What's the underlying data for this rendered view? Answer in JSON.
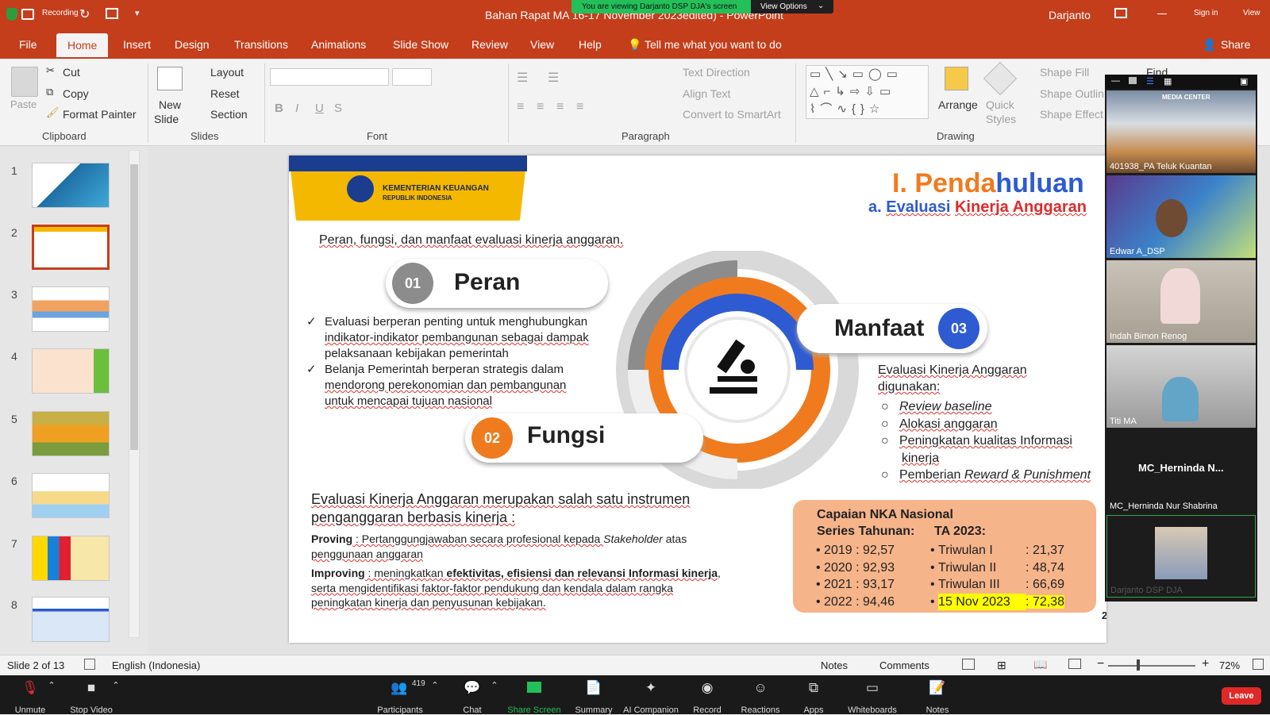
{
  "zoom_banner": {
    "text": "You are viewing Darjanto DSP DJA's screen",
    "options": "View Options"
  },
  "titlebar": {
    "recording": "Recording",
    "title": "Bahan Rapat MA 16-17 November 2023edited) - PowerPoint",
    "user": "Darjanto",
    "signin": "Sign in",
    "view": "View"
  },
  "menu": {
    "file": "File",
    "home": "Home",
    "insert": "Insert",
    "design": "Design",
    "transitions": "Transitions",
    "animations": "Animations",
    "slideshow": "Slide Show",
    "review": "Review",
    "view": "View",
    "help": "Help",
    "tell": "Tell me what you want to do",
    "share": "Share"
  },
  "ribbon": {
    "paste": "Paste",
    "cut": "Cut",
    "copy": "Copy",
    "format_painter": "Format Painter",
    "clipboard": "Clipboard",
    "new_slide_1": "New",
    "new_slide_2": "Slide",
    "layout": "Layout",
    "reset": "Reset",
    "section": "Section",
    "slides": "Slides",
    "font": "Font",
    "paragraph": "Paragraph",
    "text_direction": "Text Direction",
    "align_text": "Align Text",
    "convert_smartart": "Convert to SmartArt",
    "arrange": "Arrange",
    "quick_styles_1": "Quick",
    "quick_styles_2": "Styles",
    "shape_fill": "Shape Fill",
    "shape_outline": "Shape Outlin",
    "shape_effects": "Shape Effect",
    "drawing": "Drawing",
    "find": "Find"
  },
  "thumbnails": [
    "1",
    "2",
    "3",
    "4",
    "5",
    "6",
    "7",
    "8"
  ],
  "slide": {
    "ministry_1": "KEMENTERIAN KEUANGAN",
    "ministry_2": "REPUBLIK INDONESIA",
    "title_a": "I. Penda",
    "title_b": "huluan",
    "subtitle_a": "a. ",
    "subtitle_b": "Evaluasi",
    "subtitle_c": "Kinerja Anggaran",
    "intro": "Peran, fungsi, dan manfaat evaluasi kinerja anggaran.",
    "n01": "01",
    "peran": "Peran",
    "n02": "02",
    "fungsi": "Fungsi",
    "n03": "03",
    "manfaat": "Manfaat",
    "check": "✓",
    "peran_b1": [
      "Evaluasi berperan penting untuk menghubungkan",
      "indikator-indikator pembangunan sebagai dampak",
      "pelaksanaan kebijakan pemerintah"
    ],
    "peran_b2": [
      "Belanja Pemerintah berperan strategis dalam",
      "mendorong perekonomian dan pembangunan",
      "untuk mencapai tujuan nasional"
    ],
    "manfaat_head": [
      "Evaluasi Kinerja Anggaran",
      "digunakan:"
    ],
    "manfaat_items": [
      "Review baseline",
      "Alokasi anggaran",
      "Peningkatan kualitas Informasi",
      "kinerja",
      "Pemberian ",
      "Reward & Punishment"
    ],
    "instr": [
      "Evaluasi Kinerja Anggaran merupakan salah satu instrumen",
      "penganggaran berbasis kinerja :"
    ],
    "proving_label": "Proving",
    "proving_text": " : Pertanggungjawaban secara profesional kepada ",
    "stakeholder": "Stakeholder",
    "proving_end": " atas",
    "proving_2": "penggunaan anggaran",
    "improving_label": "Improving",
    "improving_text": " : meningkatkan ",
    "improving_bold": "efektivitas, efisiensi dan relevansi Informasi kinerja",
    ",": ",",
    "improving_2": "serta mengidentifikasi faktor-faktor pendukung dan kendala dalam rangka",
    "improving_3": "peningkatan kinerja dan penyusunan kebijakan.",
    "capaian_title": "Capaian NKA Nasional",
    "series_title": "Series Tahunan:",
    "ta_title": "TA 2023:",
    "series": [
      {
        "y": "2019",
        "v": "92,57"
      },
      {
        "y": "2020",
        "v": "92,93"
      },
      {
        "y": "2021",
        "v": "93,17"
      },
      {
        "y": "2022",
        "v": "94,46"
      }
    ],
    "ta": [
      {
        "k": "Triwulan I",
        "v": ": 21,37"
      },
      {
        "k": "Triwulan II",
        "v": ": 48,74"
      },
      {
        "k": "Triwulan III",
        "v": ": 66,69"
      },
      {
        "k": "15 Nov 2023",
        "v": ": 72,38"
      }
    ],
    "page_no": "2"
  },
  "participants": [
    "401938_PA Teluk Kuantan",
    "Edwar A_DSP",
    "Indah Bimon Renog",
    "Titi MA",
    "MC_Herninda  N...",
    "MC_Herninda Nur Shabrina",
    "Darjanto DSP DJA"
  ],
  "video_banner": "MEDIA CENTER",
  "status": {
    "slide": "Slide 2 of 13",
    "language": "English (Indonesia)",
    "notes": "Notes",
    "comments": "Comments",
    "zoom": "72%"
  },
  "zoom": {
    "unmute": "Unmute",
    "stop_video": "Stop Video",
    "participants": "Participants",
    "count": "419",
    "chat": "Chat",
    "share": "Share Screen",
    "summary": "Summary",
    "ai": "AI Companion",
    "record": "Record",
    "reactions": "Reactions",
    "apps": "Apps",
    "whiteboards": "Whiteboards",
    "notes": "Notes",
    "leave": "Leave"
  },
  "colors": {
    "ppt_red": "#c43e1c",
    "orange": "#f07b1e",
    "blue": "#2e5bd1",
    "yellow": "#f5b800",
    "peach": "#f6b48a",
    "highlight": "#ffff00"
  }
}
